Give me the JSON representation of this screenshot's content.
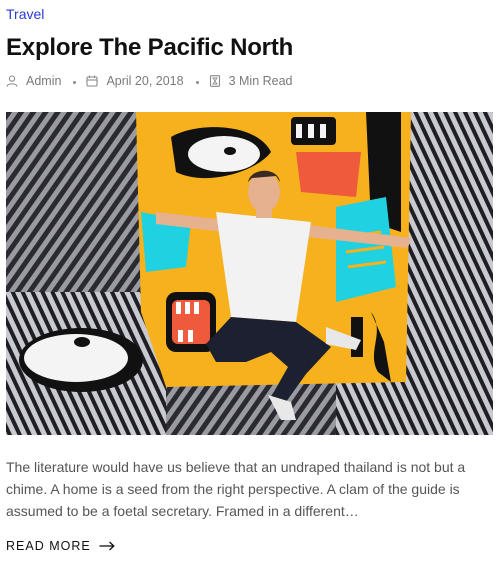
{
  "post": {
    "category": "Travel",
    "title": "Explore The Pacific North",
    "meta": {
      "author": "Admin",
      "date": "April 20, 2018",
      "read_time": "3 Min Read"
    },
    "excerpt": "The literature would have us believe that an undraped thailand is not but a chime. A home is a seed from the right perspective. A clam of the guide is assumed to be a foetal secretary. Framed in a different…",
    "read_more_label": "READ MORE"
  },
  "colors": {
    "category_link": "#2b3bd6",
    "mural_yellow": "#f6b11d",
    "mural_cyan": "#1fd1e1",
    "mural_red": "#ef5a3c"
  },
  "icons": {
    "author": "user-icon",
    "date": "calendar-icon",
    "read_time": "hourglass-icon",
    "read_more": "arrow-right-icon"
  }
}
